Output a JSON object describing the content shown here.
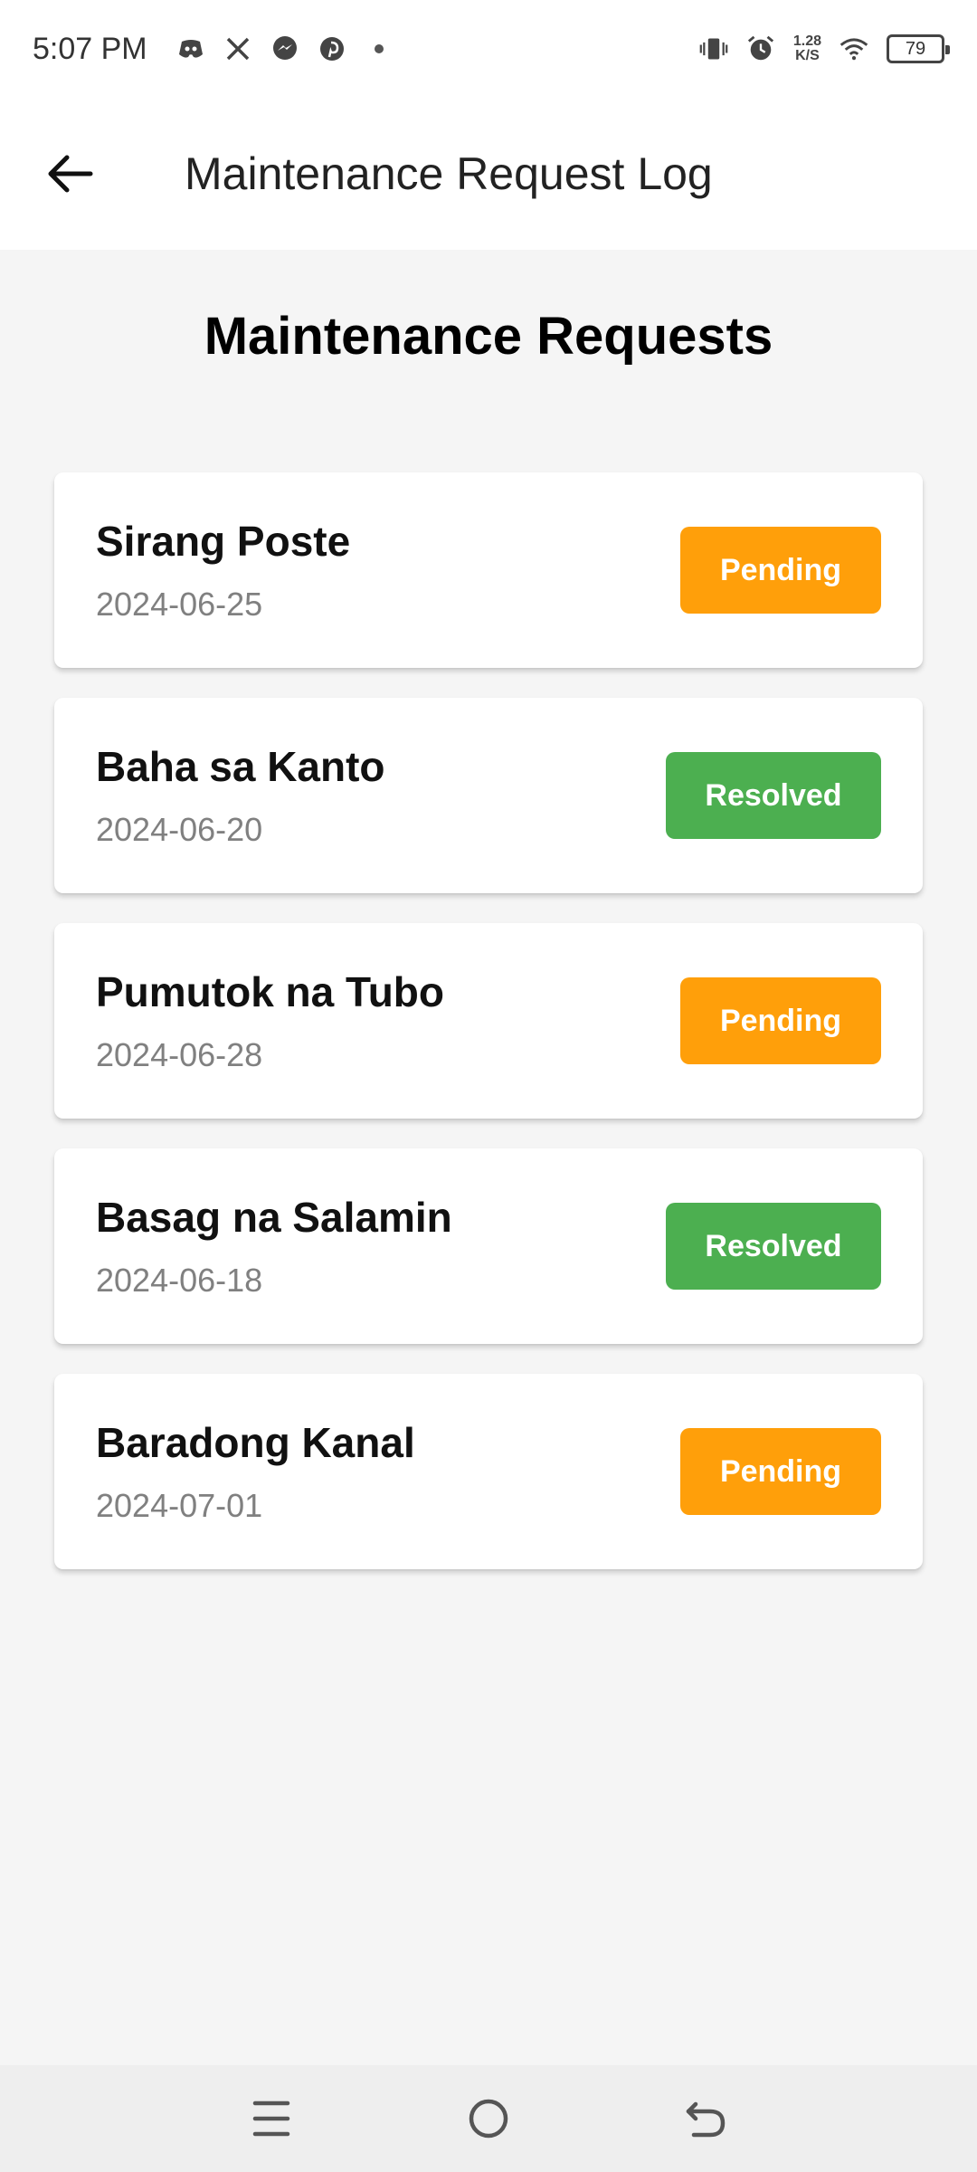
{
  "status_bar": {
    "time": "5:07 PM",
    "notification_icons": [
      "discord-icon",
      "x-icon",
      "messenger-icon",
      "pinterest-icon",
      "dot-icon"
    ],
    "speed_value": "1.28",
    "speed_unit": "K/S",
    "battery": "79"
  },
  "app_bar": {
    "title": "Maintenance Request Log"
  },
  "main": {
    "title": "Maintenance Requests",
    "requests": [
      {
        "title": "Sirang Poste",
        "date": "2024-06-25",
        "status": "Pending"
      },
      {
        "title": "Baha sa Kanto",
        "date": "2024-06-20",
        "status": "Resolved"
      },
      {
        "title": "Pumutok na Tubo",
        "date": "2024-06-28",
        "status": "Pending"
      },
      {
        "title": "Basag na Salamin",
        "date": "2024-06-18",
        "status": "Resolved"
      },
      {
        "title": "Baradong Kanal",
        "date": "2024-07-01",
        "status": "Pending"
      }
    ]
  },
  "colors": {
    "pending": "#ff9f0a",
    "resolved": "#4caf50",
    "background": "#f5f5f5"
  }
}
